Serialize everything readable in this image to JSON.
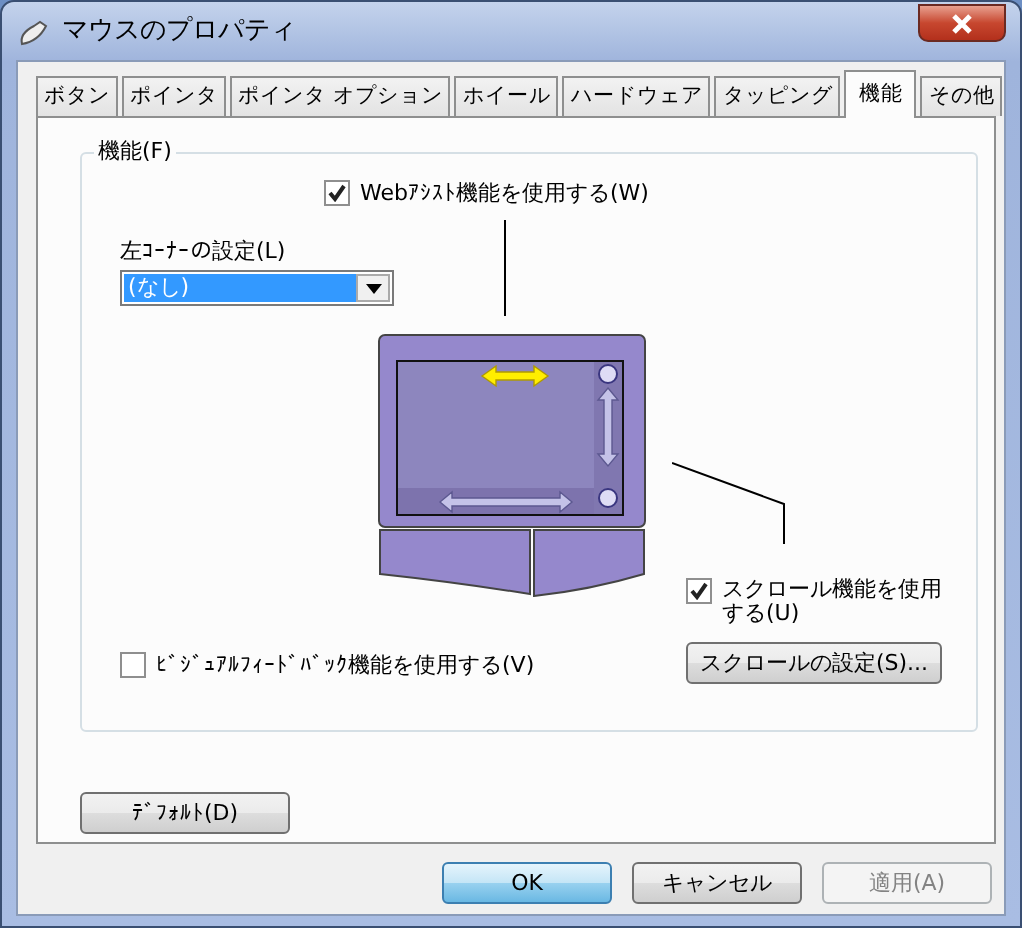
{
  "window": {
    "title": "マウスのプロパティ"
  },
  "tabs": [
    {
      "label": "ボタン",
      "selected": false
    },
    {
      "label": "ポインタ",
      "selected": false
    },
    {
      "label": "ポインタ オプション",
      "selected": false
    },
    {
      "label": "ホイール",
      "selected": false
    },
    {
      "label": "ハードウェア",
      "selected": false
    },
    {
      "label": "タッピング",
      "selected": false
    },
    {
      "label": "機能",
      "selected": true
    },
    {
      "label": "その他",
      "selected": false
    }
  ],
  "group": {
    "label": "機能(F)",
    "web_assist": {
      "label": "Webｱｼｽﾄ機能を使用する(W)",
      "checked": true
    },
    "left_corner": {
      "label": "左ｺｰﾅｰの設定(L)",
      "value": "(なし)"
    },
    "scroll": {
      "label": "スクロール機能を使用する(U)",
      "checked": true
    },
    "scroll_settings_button": "スクロールの設定(S)...",
    "visual_feedback": {
      "label": "ﾋﾞｼﾞｭｱﾙﾌｨｰﾄﾞﾊﾞｯｸ機能を使用する(V)",
      "checked": false
    }
  },
  "default_button": "ﾃﾞﾌｫﾙﾄ(D)",
  "buttons": [
    {
      "label": "OK",
      "kind": "default",
      "disabled": false
    },
    {
      "label": "キャンセル",
      "kind": "normal",
      "disabled": false
    },
    {
      "label": "適用(A)",
      "kind": "normal",
      "disabled": true
    }
  ]
}
